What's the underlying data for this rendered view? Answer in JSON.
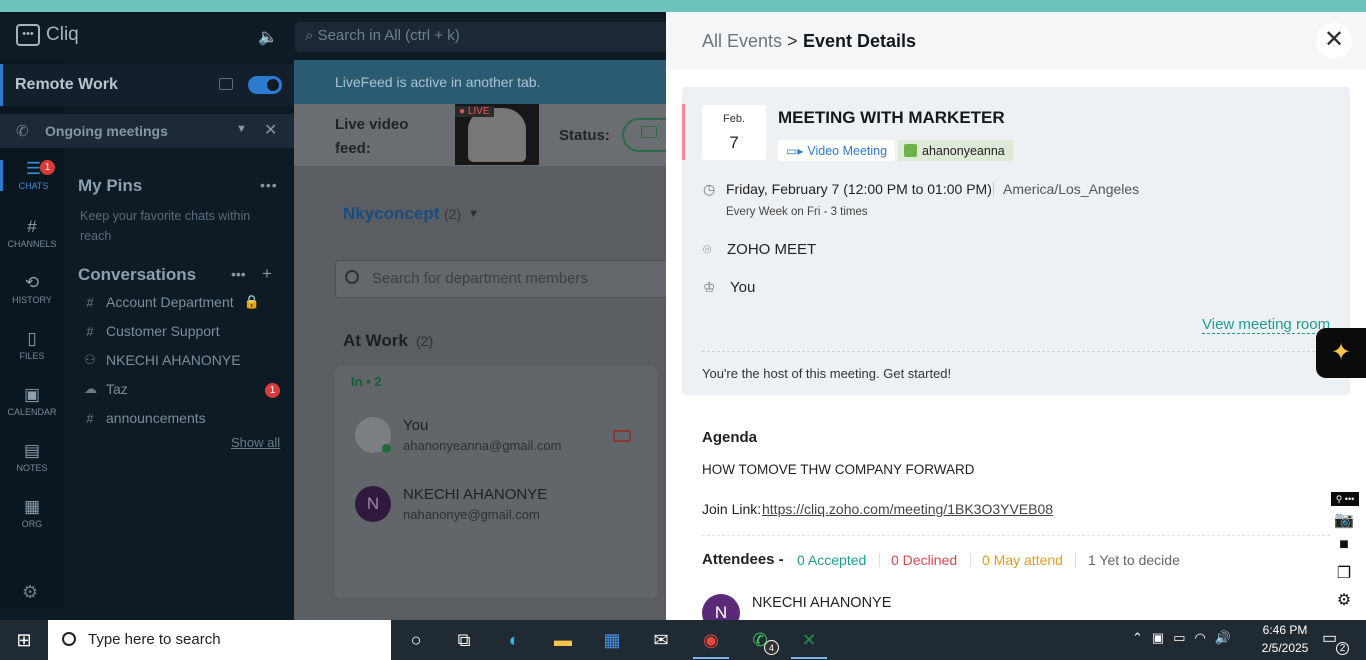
{
  "app": {
    "name": "Cliq",
    "search_placeholder": "Search in All (ctrl + k)"
  },
  "workspace": {
    "name": "Remote Work",
    "ongoing_label": "Ongoing meetings"
  },
  "rail": [
    {
      "label": "CHATS",
      "icon": "chat-icon",
      "badge": "1",
      "active": true
    },
    {
      "label": "CHANNELS",
      "icon": "hash-icon"
    },
    {
      "label": "HISTORY",
      "icon": "history-icon"
    },
    {
      "label": "FILES",
      "icon": "file-icon"
    },
    {
      "label": "CALENDAR",
      "icon": "calendar-icon"
    },
    {
      "label": "NOTES",
      "icon": "notes-icon"
    },
    {
      "label": "ORG",
      "icon": "org-icon"
    }
  ],
  "pins": {
    "title": "My Pins",
    "description": "Keep your favorite chats within reach"
  },
  "conversations": {
    "title": "Conversations",
    "items": [
      {
        "name": "Account Department",
        "icon": "#",
        "locked": true
      },
      {
        "name": "Customer Support",
        "icon": "#"
      },
      {
        "name": "NKECHI AHANONYE",
        "icon": "bot"
      },
      {
        "name": "Taz",
        "icon": "bot",
        "badge": "1"
      },
      {
        "name": "announcements",
        "icon": "#"
      }
    ],
    "show_all": "Show all"
  },
  "middle": {
    "livefeed_notice": "LiveFeed is active in another tab.",
    "live_video_label": "Live video feed:",
    "live_tag": "LIVE",
    "status_label": "Status:",
    "department": "Nkyconcept",
    "department_count": "(2)",
    "member_search_placeholder": "Search for department members",
    "at_work_label": "At Work",
    "at_work_count": "(2)",
    "in_label": "In • 2",
    "members": [
      {
        "name": "You",
        "email": "ahanonyeanna@gmail.com"
      },
      {
        "name": "NKECHI AHANONYE",
        "email": "nahanonye@gmail.com",
        "initial": "N"
      }
    ]
  },
  "event": {
    "breadcrumb_all": "All Events",
    "breadcrumb_sep": ">",
    "breadcrumb_current": "Event Details",
    "month": "Feb.",
    "day": "7",
    "title": "MEETING WITH MARKETER",
    "tag_video": "Video Meeting",
    "tag_user": "ahanonyeanna",
    "time": "Friday, February 7 (12:00 PM to 01:00 PM)",
    "timezone": "America/Los_Angeles",
    "recurrence": "Every Week on Fri - 3 times",
    "location": "ZOHO MEET",
    "host": "You",
    "view_room": "View meeting room",
    "host_message": "You're the host of this meeting. Get started!",
    "agenda_title": "Agenda",
    "agenda_text": "HOW TOMOVE THW COMPANY FORWARD",
    "join_label": "Join Link:",
    "join_link": "https://cliq.zoho.com/meeting/1BK3O3YVEB08",
    "attendees_label": "Attendees -",
    "accepted": "0 Accepted",
    "declined": "0 Declined",
    "may_attend": "0 May attend",
    "yet_to_decide": "1 Yet to decide",
    "attendee_initial": "N",
    "attendee_name": "NKECHI AHANONYE"
  },
  "taskbar": {
    "search_placeholder": "Type here to search",
    "whatsapp_badge": "4",
    "time": "6:46 PM",
    "date": "2/5/2025",
    "notification_count": "2"
  },
  "colors": {
    "accent_blue": "#2d7ad1",
    "teal_link": "#1f9e8f",
    "accepted": "#1f9e8f",
    "declined": "#e0464e",
    "may_attend": "#e39c1a"
  }
}
